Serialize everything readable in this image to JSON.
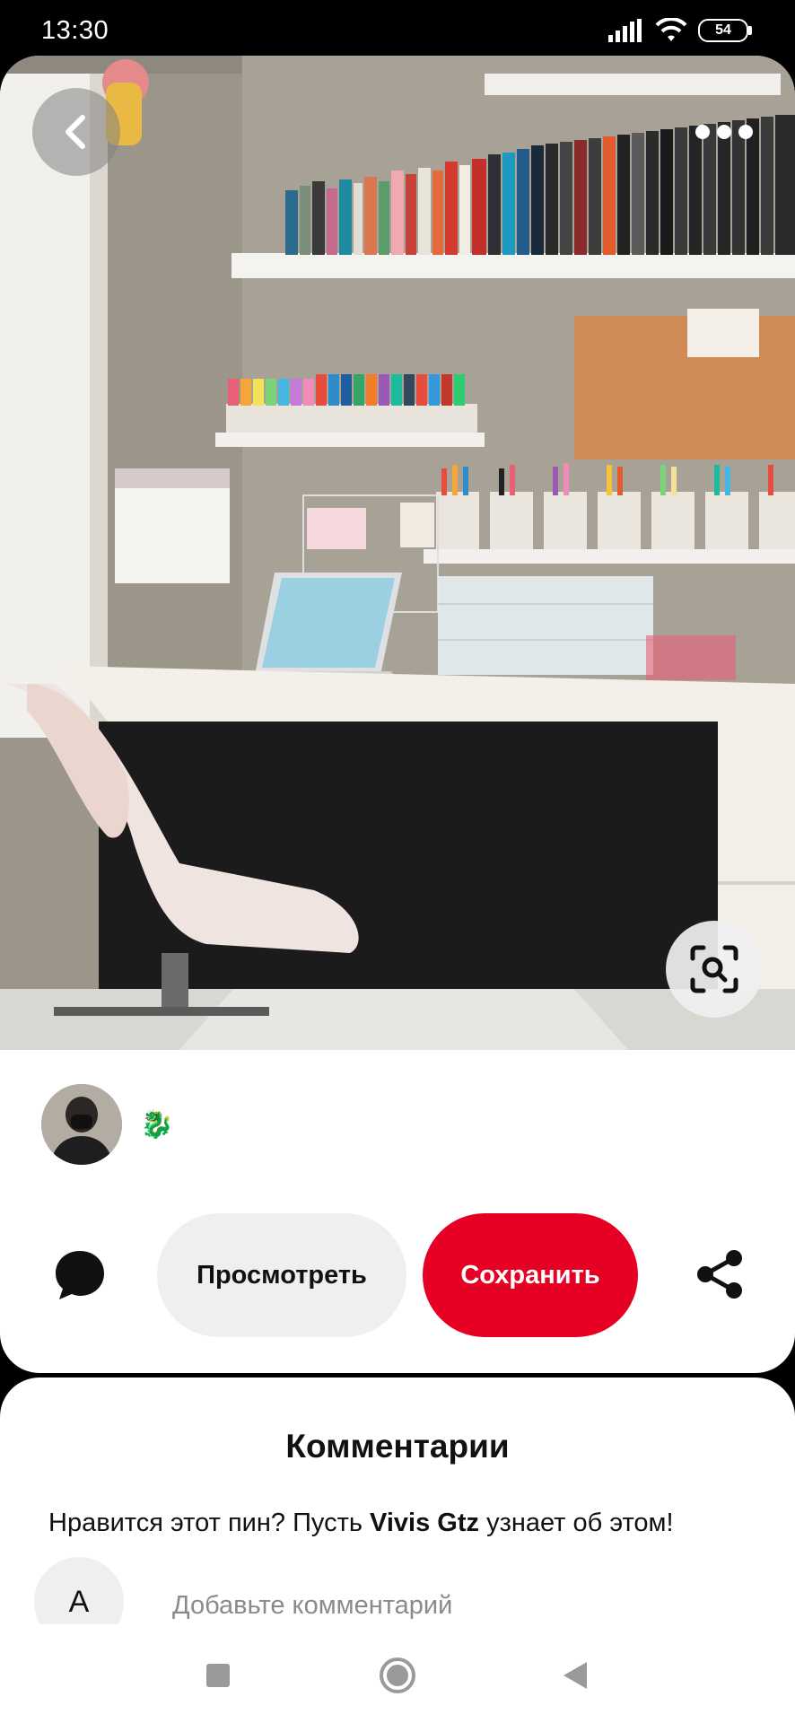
{
  "status_bar": {
    "time": "13:30",
    "battery_level": "54"
  },
  "pin": {
    "author_emoji": "🐉",
    "actions": {
      "view_label": "Просмотреть",
      "save_label": "Сохранить"
    }
  },
  "comments": {
    "title": "Комментарии",
    "prompt_before": "Нравится этот пин? Пусть ",
    "prompt_author": "Vivis Gtz",
    "prompt_after": " узнает об этом!",
    "user_initial": "A",
    "input_placeholder": "Добавьте комментарий"
  },
  "colors": {
    "save_button": "#e60023",
    "view_button": "#efefef"
  },
  "icons": [
    "back-arrow-icon",
    "more-options-icon",
    "visual-search-icon",
    "comment-icon",
    "share-icon",
    "nav-recents-icon",
    "nav-home-icon",
    "nav-back-icon",
    "signal-icon",
    "wifi-icon",
    "battery-icon"
  ]
}
